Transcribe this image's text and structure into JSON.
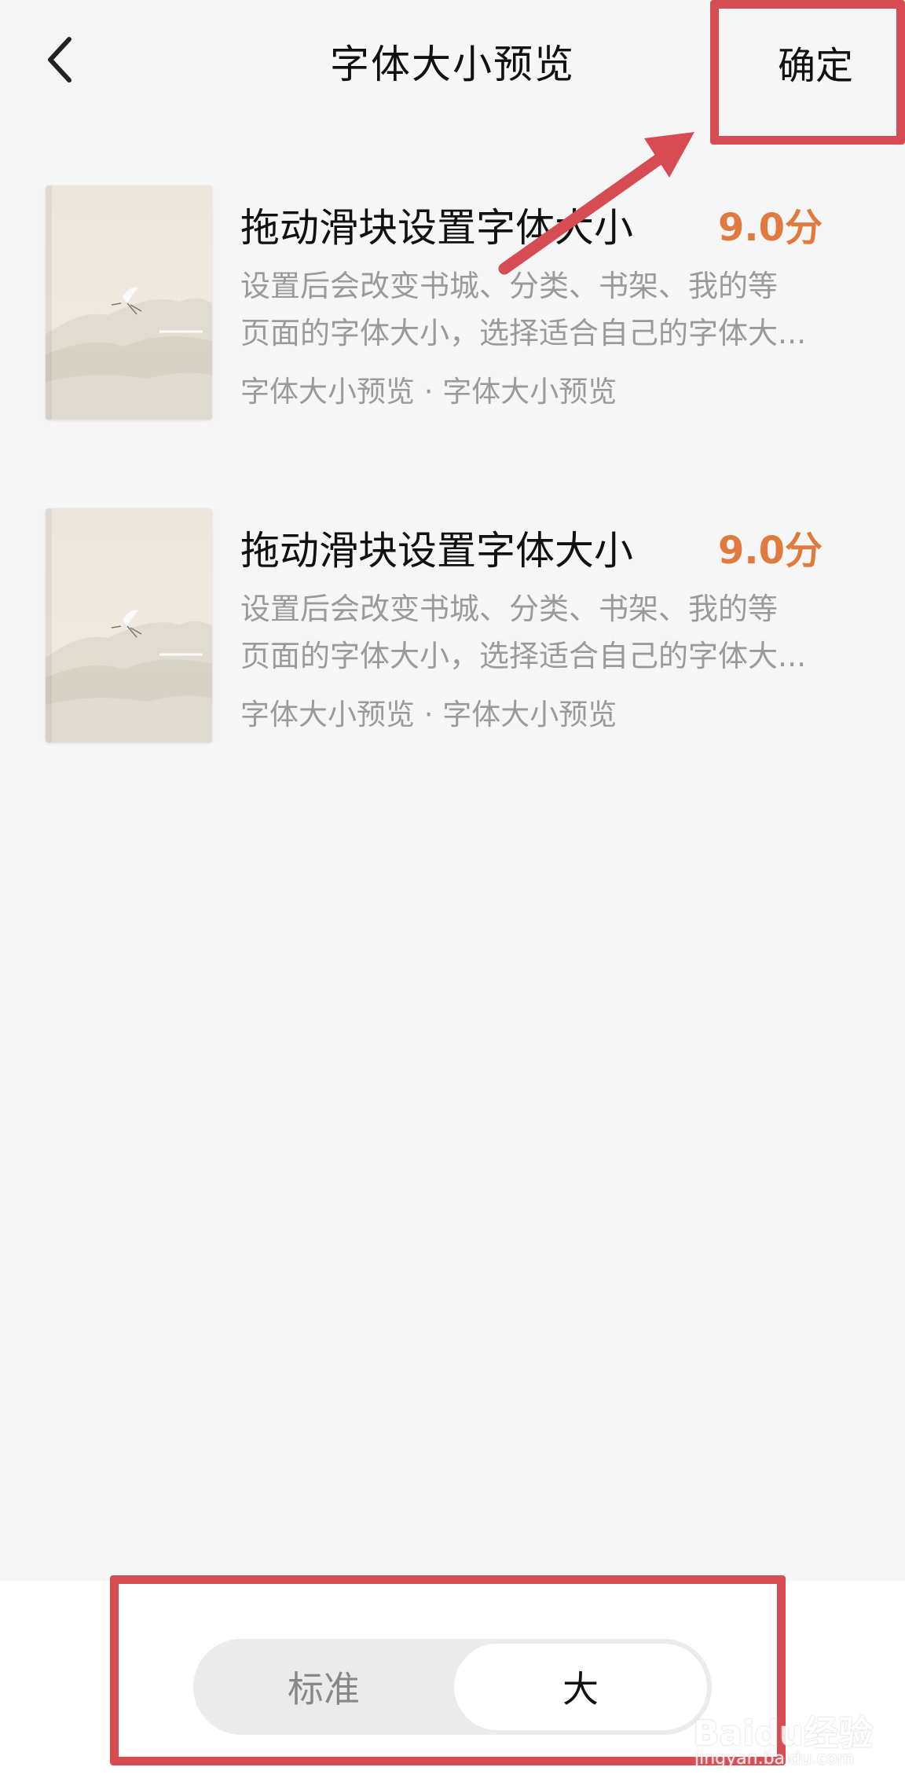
{
  "header": {
    "title": "字体大小预览",
    "confirm_label": "确定"
  },
  "books": [
    {
      "title": "拖动滑块设置字体大小",
      "score": "9.0分",
      "desc_line1": "设置后会改变书城、分类、书架、我的等",
      "desc_line2": "页面的字体大小，选择适合自己的字体大...",
      "meta": "字体大小预览 · 字体大小预览"
    },
    {
      "title": "拖动滑块设置字体大小",
      "score": "9.0分",
      "desc_line1": "设置后会改变书城、分类、书架、我的等",
      "desc_line2": "页面的字体大小，选择适合自己的字体大...",
      "meta": "字体大小预览 · 字体大小预览"
    }
  ],
  "font_size_toggle": {
    "options": [
      "标准",
      "大"
    ],
    "selected": "大"
  },
  "watermark": {
    "logo": "Baidu经验",
    "url": "jingyan.baidu.com"
  },
  "colors": {
    "score": "#e07a3e",
    "annotation": "#d74b52",
    "background": "#f6f6f6"
  },
  "icons": {
    "back": "chevron-left-icon"
  }
}
